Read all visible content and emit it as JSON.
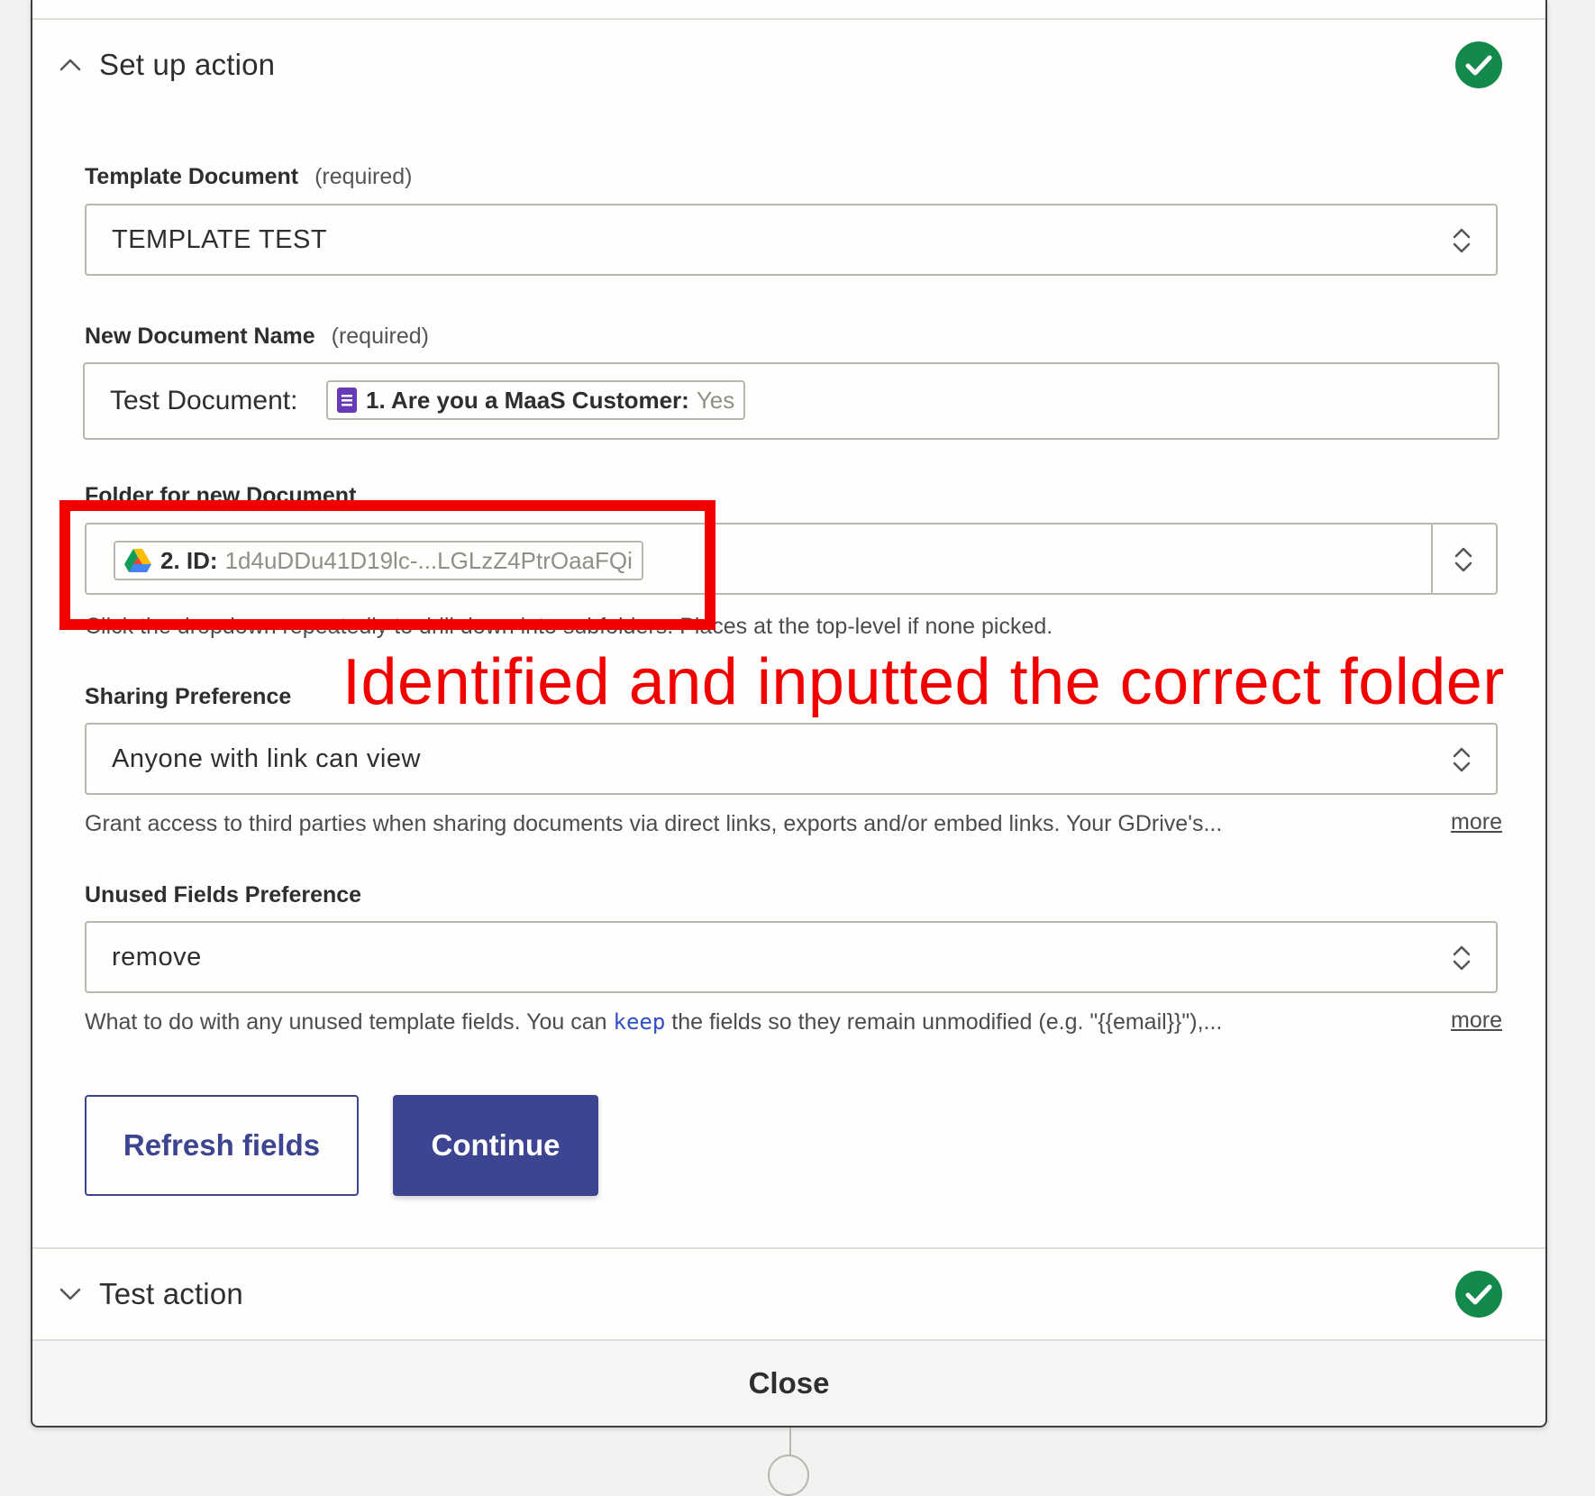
{
  "setup_section": {
    "title": "Set up action",
    "status": "complete"
  },
  "template_document": {
    "label": "Template Document",
    "required_note": "(required)",
    "value": "TEMPLATE TEST"
  },
  "new_document_name": {
    "label": "New Document Name",
    "required_note": "(required)",
    "prefix_text": "Test Document:",
    "pill_label": "1. Are you a MaaS Customer:",
    "pill_value": "Yes"
  },
  "folder": {
    "label": "Folder for new Document",
    "pill_label": "2. ID:",
    "pill_value": "1d4uDDu41D19lc-...LGLzZ4PtrOaaFQi",
    "help_start": "Click the dropdown repeatedly to drill down into subfold",
    "help_end": "ers. Places at the top-level if none picked."
  },
  "sharing_preference": {
    "label": "Sharing Preference",
    "value": "Anyone with link can view",
    "help": "Grant access to third parties when sharing documents via direct links, exports and/or embed links. Your GDrive's...",
    "more": "more"
  },
  "unused_fields": {
    "label": "Unused Fields Preference",
    "value": "remove",
    "help_before": "What to do with any unused template fields. You can ",
    "help_code": "keep",
    "help_after": " the fields so they remain unmodified (e.g. \"{{email}}\"),...",
    "more": "more"
  },
  "buttons": {
    "refresh": "Refresh fields",
    "continue": "Continue"
  },
  "test_section": {
    "title": "Test action",
    "status": "complete"
  },
  "close": "Close",
  "annotation": {
    "text": "Identified and inputted the correct folder"
  },
  "colors": {
    "accent": "#3d4592",
    "success": "#138a4b",
    "annotation": "#f20000"
  }
}
